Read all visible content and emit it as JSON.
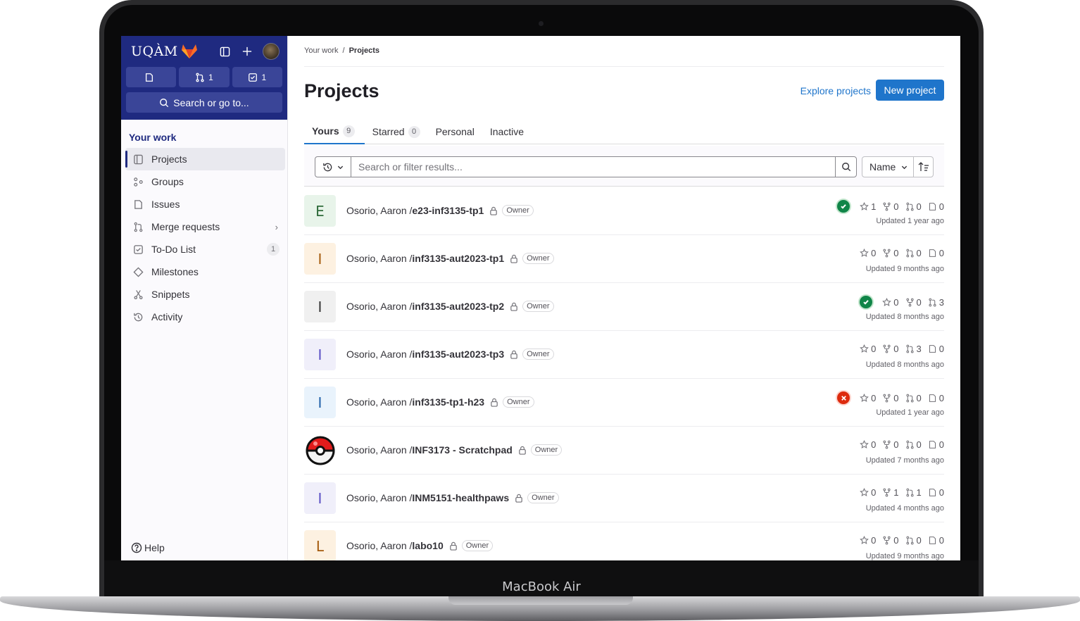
{
  "device": {
    "label": "MacBook Air"
  },
  "sidebar": {
    "logo_text": "UQÀM",
    "counts": {
      "issues": "",
      "merge_requests": "1",
      "todos": "1"
    },
    "search_label": "Search or go to...",
    "section_title": "Your work",
    "items": [
      {
        "label": "Projects",
        "icon": "project-icon"
      },
      {
        "label": "Groups",
        "icon": "group-icon"
      },
      {
        "label": "Issues",
        "icon": "issues-icon"
      },
      {
        "label": "Merge requests",
        "icon": "merge-request-icon"
      },
      {
        "label": "To-Do List",
        "icon": "todo-icon",
        "badge": "1"
      },
      {
        "label": "Milestones",
        "icon": "milestone-icon"
      },
      {
        "label": "Snippets",
        "icon": "snippet-icon"
      },
      {
        "label": "Activity",
        "icon": "history-icon"
      }
    ],
    "help_label": "Help"
  },
  "breadcrumb": {
    "parent": "Your work",
    "separator": "/",
    "current": "Projects"
  },
  "page": {
    "title": "Projects",
    "explore_label": "Explore projects",
    "new_project_label": "New project"
  },
  "tabs": [
    {
      "label": "Yours",
      "count": "9"
    },
    {
      "label": "Starred",
      "count": "0"
    },
    {
      "label": "Personal"
    },
    {
      "label": "Inactive"
    }
  ],
  "filter": {
    "placeholder": "Search or filter results...",
    "sort_label": "Name"
  },
  "colors": {
    "sidebar_bg": "#1f2a80",
    "primary": "#1f75cb",
    "success": "#108548",
    "danger": "#dd2b0e"
  },
  "projects": [
    {
      "avatar_letter": "E",
      "avatar_bg": "#e8f4ea",
      "avatar_fg": "#2e6b3a",
      "namespace": "Osorio, Aaron / ",
      "name": "e23-inf3135-tp1",
      "role": "Owner",
      "pipeline": "success",
      "stars": "1",
      "forks": "0",
      "mrs": "0",
      "issues": "0",
      "updated": "Updated 1 year ago"
    },
    {
      "avatar_letter": "I",
      "avatar_bg": "#fdf1e1",
      "avatar_fg": "#a45a0c",
      "namespace": "Osorio, Aaron / ",
      "name": "inf3135-aut2023-tp1",
      "role": "Owner",
      "pipeline": "",
      "stars": "0",
      "forks": "0",
      "mrs": "0",
      "issues": "0",
      "updated": "Updated 9 months ago"
    },
    {
      "avatar_letter": "I",
      "avatar_bg": "#f0f0f0",
      "avatar_fg": "#333333",
      "namespace": "Osorio, Aaron / ",
      "name": "inf3135-aut2023-tp2",
      "role": "Owner",
      "pipeline": "success",
      "stars": "0",
      "forks": "0",
      "mrs": "3",
      "issues": "",
      "updated": "Updated 8 months ago"
    },
    {
      "avatar_letter": "I",
      "avatar_bg": "#f0effa",
      "avatar_fg": "#5a4fc4",
      "namespace": "Osorio, Aaron / ",
      "name": "inf3135-aut2023-tp3",
      "role": "Owner",
      "pipeline": "",
      "stars": "0",
      "forks": "0",
      "mrs": "3",
      "issues": "0",
      "updated": "Updated 8 months ago"
    },
    {
      "avatar_letter": "I",
      "avatar_bg": "#e9f3fc",
      "avatar_fg": "#1f5fa8",
      "namespace": "Osorio, Aaron / ",
      "name": "inf3135-tp1-h23",
      "role": "Owner",
      "pipeline": "failed",
      "stars": "0",
      "forks": "0",
      "mrs": "0",
      "issues": "0",
      "updated": "Updated 1 year ago"
    },
    {
      "avatar_letter": "",
      "avatar_bg": "#ffffff",
      "avatar_fg": "#333333",
      "avatar_image": "pokeball",
      "namespace": "Osorio, Aaron / ",
      "name": "INF3173 - Scratchpad",
      "role": "Owner",
      "pipeline": "",
      "stars": "0",
      "forks": "0",
      "mrs": "0",
      "issues": "0",
      "updated": "Updated 7 months ago"
    },
    {
      "avatar_letter": "I",
      "avatar_bg": "#f0effa",
      "avatar_fg": "#5a4fc4",
      "namespace": "Osorio, Aaron / ",
      "name": "INM5151-healthpaws",
      "role": "Owner",
      "pipeline": "",
      "stars": "0",
      "forks": "1",
      "mrs": "1",
      "issues": "0",
      "updated": "Updated 4 months ago"
    },
    {
      "avatar_letter": "L",
      "avatar_bg": "#fdf1e1",
      "avatar_fg": "#a45a0c",
      "namespace": "Osorio, Aaron / ",
      "name": "labo10",
      "role": "Owner",
      "pipeline": "",
      "stars": "0",
      "forks": "0",
      "mrs": "0",
      "issues": "0",
      "updated": "Updated 9 months ago"
    }
  ]
}
